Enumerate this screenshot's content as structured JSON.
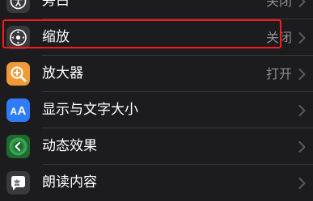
{
  "colors": {
    "background": "#000000",
    "cell": "#1c1c1e",
    "separator": "#38383a",
    "secondary_text": "#8d8d93",
    "highlight": "#ff1a1a"
  },
  "settings": {
    "items": [
      {
        "label": "旁白",
        "value": "关闭",
        "icon": "voiceover-icon",
        "icon_color": "#3a3a3c"
      },
      {
        "label": "缩放",
        "value": "关闭",
        "icon": "zoom-icon",
        "icon_color": "#3a3a3c"
      },
      {
        "label": "放大器",
        "value": "打开",
        "icon": "magnifier-icon",
        "icon_color": "#f19a37"
      },
      {
        "label": "显示与文字大小",
        "value": "",
        "icon": "display-text-size-icon",
        "icon_color": "#2f7cf6"
      },
      {
        "label": "动态效果",
        "value": "",
        "icon": "motion-icon",
        "icon_color": "#34a853"
      },
      {
        "label": "朗读内容",
        "value": "",
        "icon": "spoken-content-icon",
        "icon_color": "#3a3a3c"
      }
    ]
  }
}
